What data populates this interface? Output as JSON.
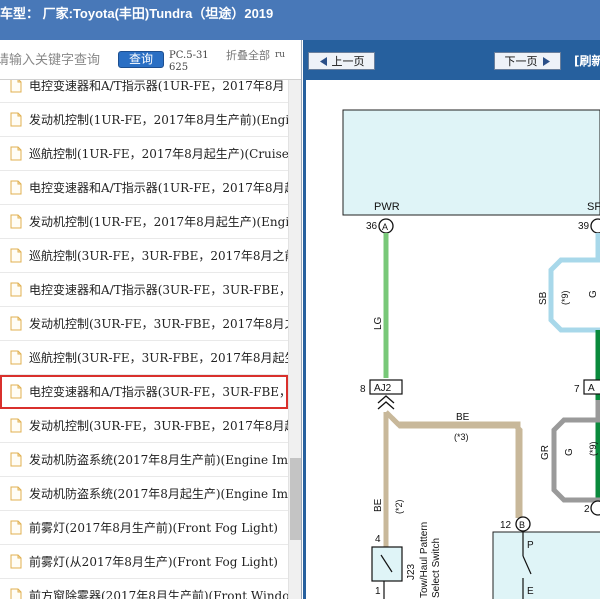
{
  "window": {
    "title": "车型： 厂家:Toyota(丰田)Tundra（坦途）2019"
  },
  "search": {
    "placeholder": "请输入关键字查询",
    "query_button": "查询",
    "pc_code": "PC.5-31625",
    "collapse_all": "折叠全部",
    "extra_label": "ru"
  },
  "tree": {
    "items": [
      {
        "label": "电控变速器和A/T指示器(1UR-FE，2017年8月"
      },
      {
        "label": "发动机控制(1UR-FE，2017年8月生产前)(Engi"
      },
      {
        "label": "巡航控制(1UR-FE，2017年8月起生产)(Cruise C"
      },
      {
        "label": "电控变速器和A/T指示器(1UR-FE，2017年8月起"
      },
      {
        "label": "发动机控制(1UR-FE，2017年8月起生产)(Engin"
      },
      {
        "label": "巡航控制(3UR-FE，3UR-FBE，2017年8月之前"
      },
      {
        "label": "电控变速器和A/T指示器(3UR-FE，3UR-FBE，"
      },
      {
        "label": "发动机控制(3UR-FE，3UR-FBE，2017年8月之"
      },
      {
        "label": "巡航控制(3UR-FE，3UR-FBE，2017年8月起生"
      },
      {
        "label": "电控变速器和A/T指示器(3UR-FE，3UR-FBE，2"
      },
      {
        "label": "发动机控制(3UR-FE，3UR-FBE，2017年8月起"
      },
      {
        "label": "发动机防盗系统(2017年8月生产前)(Engine Imm"
      },
      {
        "label": "发动机防盗系统(2017年8月起生产)(Engine Imm"
      },
      {
        "label": "前雾灯(2017年8月生产前)(Front Fog Light)"
      },
      {
        "label": "前雾灯(从2017年8月生产)(Front Fog Light)"
      },
      {
        "label": "前方窗除雾器(2017年8月生产前)(Front Windo"
      }
    ],
    "selected_index": 9
  },
  "viewer": {
    "prev_page": "上一页",
    "next_page": "下一页",
    "refresh": "[刷新"
  },
  "diagram": {
    "pwr_label": "PWR",
    "sft_label": "SFT",
    "pin_36": "36",
    "pin_39": "39",
    "conn_a": "A",
    "wire_lg": "LG",
    "wire_sb": "SB",
    "wire_g": "G",
    "note_9": "(*9)",
    "pin_8": "8",
    "pin_7": "7",
    "conn_aj2": "AJ2",
    "conn_a_right": "A",
    "wire_be": "BE",
    "note_3": "(*3)",
    "wire_gr": "GR",
    "note_2": "(*2)",
    "pin_12": "12",
    "conn_b": "B",
    "pin_2": "2",
    "pin_4": "4",
    "pin_1": "1",
    "j23_code": "J23",
    "j23_name_1": "Tow/Haul Pattern",
    "j23_name_2": "Select Switch",
    "switch_p": "P",
    "switch_e": "E"
  }
}
